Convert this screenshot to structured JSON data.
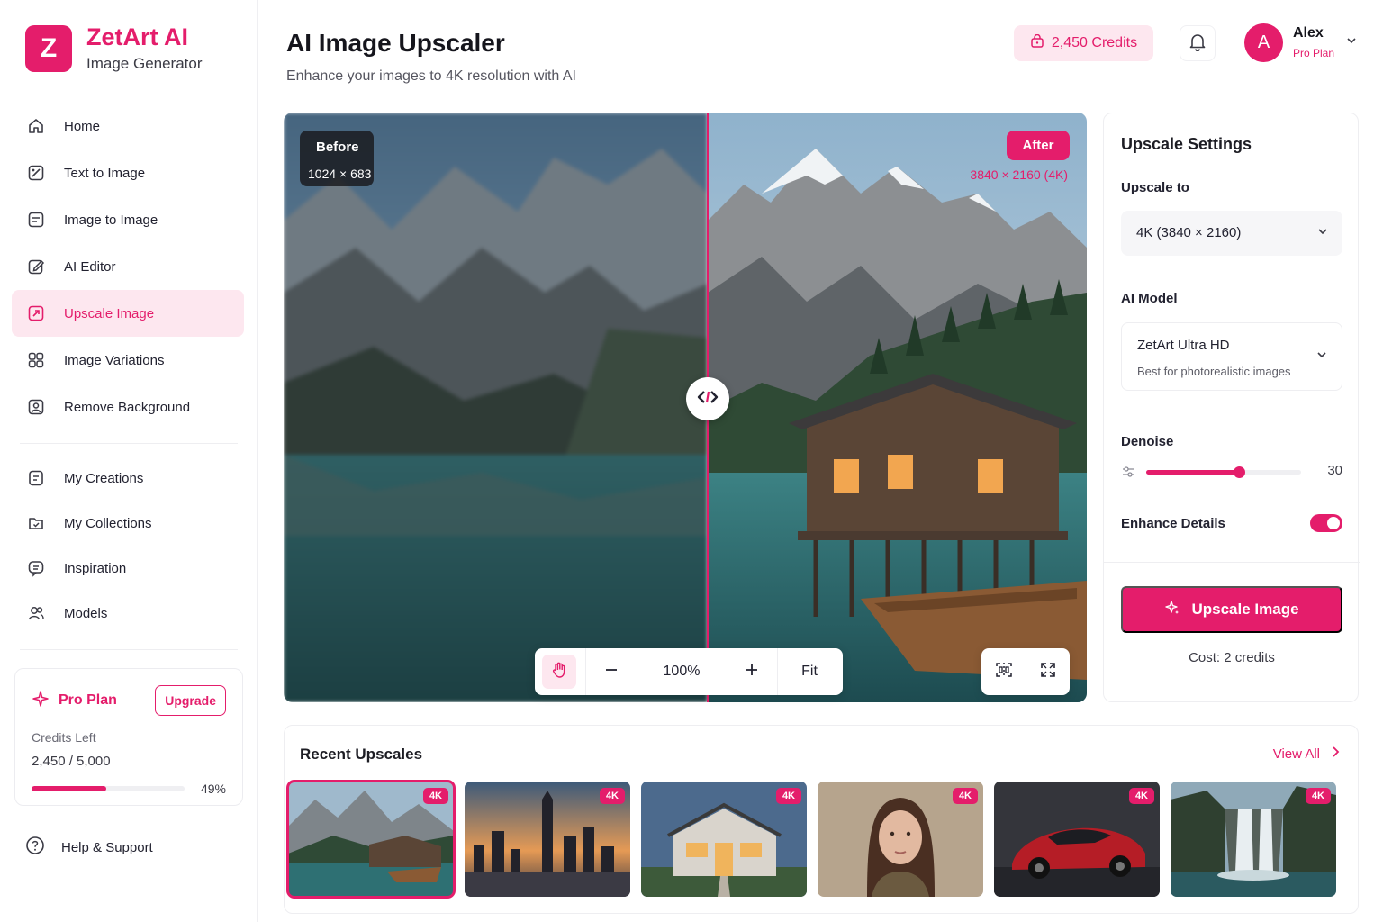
{
  "brand": {
    "logo_letter": "Z",
    "name": "ZetArt AI",
    "subtitle": "Image Generator",
    "accent": "#e41d6b"
  },
  "sidebar": {
    "primary": [
      {
        "label": "Home",
        "icon": "home-icon"
      },
      {
        "label": "Text to Image",
        "icon": "text-image-icon"
      },
      {
        "label": "Image to Image",
        "icon": "image-to-image-icon"
      },
      {
        "label": "AI Editor",
        "icon": "edit-icon"
      },
      {
        "label": "Upscale Image",
        "icon": "upscale-icon",
        "active": true
      },
      {
        "label": "Image Variations",
        "icon": "variations-icon"
      },
      {
        "label": "Remove Background",
        "icon": "remove-bg-icon"
      }
    ],
    "secondary": [
      {
        "label": "My Creations",
        "icon": "creations-icon"
      },
      {
        "label": "My Collections",
        "icon": "collections-icon"
      },
      {
        "label": "Inspiration",
        "icon": "inspiration-icon"
      },
      {
        "label": "Models",
        "icon": "models-icon"
      }
    ],
    "plan": {
      "title": "Pro Plan",
      "upgrade_label": "Upgrade",
      "credits_label": "Credits Left",
      "credits_value": "2,450 / 5,000",
      "progress_percent": 49,
      "progress_text": "49%"
    },
    "help_label": "Help & Support"
  },
  "header": {
    "title": "AI Image Upscaler",
    "subtitle": "Enhance your images to 4K resolution with AI",
    "credits_label": "2,450 Credits",
    "user": {
      "initial": "A",
      "name": "Alex",
      "plan": "Pro Plan"
    }
  },
  "viewer": {
    "before_label": "Before",
    "before_dims": "1024 × 683",
    "after_label": "After",
    "after_dims": "3840 × 2160 (4K)",
    "zoom": "100%",
    "fit_label": "Fit"
  },
  "settings": {
    "title": "Upscale Settings",
    "upscale_label": "Upscale to",
    "upscale_value": "4K (3840 × 2160)",
    "model_label": "AI Model",
    "model_value": "ZetArt Ultra HD",
    "model_desc": "Best for photorealistic images",
    "denoise_label": "Denoise",
    "denoise_value": 30,
    "denoise_display": "30",
    "denoise_max": 50,
    "enhance_label": "Enhance Details",
    "enhance_on": true,
    "button_label": "Upscale Image",
    "cost": "Cost: 2 credits"
  },
  "recent": {
    "title": "Recent Upscales",
    "view_all": "View All",
    "items": [
      {
        "name": "mountain-lake-cabin",
        "badge": "4K",
        "selected": true
      },
      {
        "name": "city-skyline-sunset",
        "badge": "4K"
      },
      {
        "name": "modern-house-night",
        "badge": "4K"
      },
      {
        "name": "woman-portrait",
        "badge": "4K"
      },
      {
        "name": "red-sports-car",
        "badge": "4K"
      },
      {
        "name": "waterfall",
        "badge": "4K"
      }
    ]
  }
}
